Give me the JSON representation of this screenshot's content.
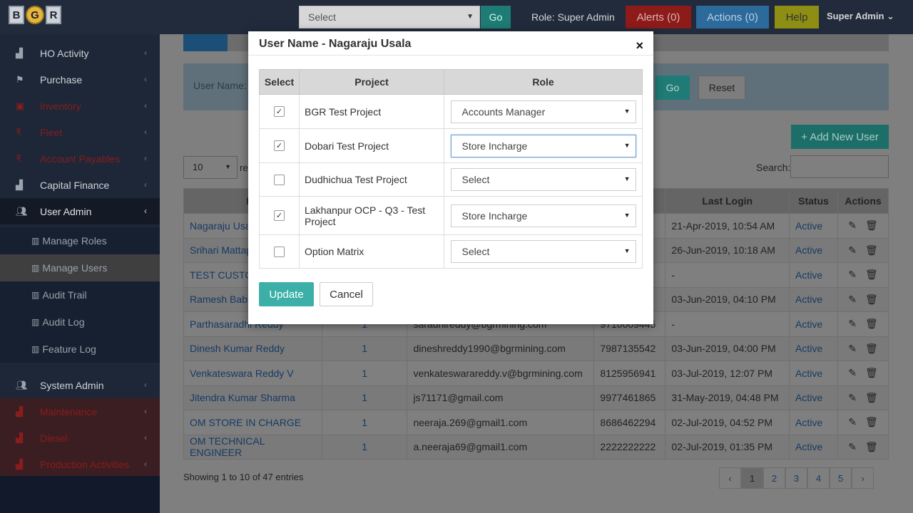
{
  "header": {
    "logo": [
      "B",
      "G",
      "R"
    ],
    "project_select": "Select",
    "go_label": "Go",
    "role_text": "Role: Super Admin",
    "alerts_label": "Alerts (0)",
    "actions_label": "Actions (0)",
    "help_label": "Help",
    "user_menu": "Super Admin"
  },
  "sidebar": {
    "items": [
      {
        "label": "HO Activity",
        "icon": "chart-icon"
      },
      {
        "label": "Purchase",
        "icon": "flag-icon"
      },
      {
        "label": "Inventory",
        "icon": "box-icon"
      },
      {
        "label": "Fleet",
        "icon": "rupee-icon"
      },
      {
        "label": "Account Payables",
        "icon": "rupee-icon"
      },
      {
        "label": "Capital Finance",
        "icon": "chart-icon"
      },
      {
        "label": "User Admin",
        "icon": "users-icon"
      }
    ],
    "subitems": [
      "Manage Roles",
      "Manage Users",
      "Audit Trail",
      "Audit Log",
      "Feature Log"
    ],
    "items_after": [
      {
        "label": "System Admin",
        "icon": "users-icon"
      },
      {
        "label": "Maintenance",
        "icon": "chart-icon"
      },
      {
        "label": "Diesel",
        "icon": "chart-icon"
      },
      {
        "label": "Production Activities",
        "icon": "chart-icon"
      }
    ]
  },
  "page": {
    "filter_label": "User Name:",
    "go_label": "Go",
    "reset_label": "Reset",
    "add_user_label": "+ Add New User",
    "page_length": "10",
    "length_suffix": "re",
    "search_label": "Search:",
    "columns": [
      "Na",
      "",
      "",
      "",
      "Last Login",
      "Status",
      "Actions"
    ],
    "rows": [
      {
        "name": "Nagaraju Usa",
        "count": "",
        "email": "",
        "phone": "4",
        "last_login": "21-Apr-2019, 10:54 AM",
        "status": "Active"
      },
      {
        "name": "Srihari Mattap",
        "count": "",
        "email": "",
        "phone": "9",
        "last_login": "26-Jun-2019, 10:18 AM",
        "status": "Active"
      },
      {
        "name": "TEST CUSTOM",
        "count": "",
        "email": "",
        "phone": "0",
        "last_login": "-",
        "status": "Active"
      },
      {
        "name": "Ramesh Babu",
        "count": "",
        "email": "",
        "phone": "0",
        "last_login": "03-Jun-2019, 04:10 PM",
        "status": "Active"
      },
      {
        "name": "Parthasaradhi Reddy",
        "count": "1",
        "email": "saradhireddy@bgrmining.com",
        "phone": "9710009445",
        "last_login": "-",
        "status": "Active"
      },
      {
        "name": "Dinesh Kumar Reddy",
        "count": "1",
        "email": "dineshreddy1990@bgrmining.com",
        "phone": "7987135542",
        "last_login": "03-Jun-2019, 04:00 PM",
        "status": "Active"
      },
      {
        "name": "Venkateswara Reddy V",
        "count": "1",
        "email": "venkateswarareddy.v@bgrmining.com",
        "phone": "8125956941",
        "last_login": "03-Jul-2019, 12:07 PM",
        "status": "Active"
      },
      {
        "name": "Jitendra Kumar Sharma",
        "count": "1",
        "email": "js71171@gmail.com",
        "phone": "9977461865",
        "last_login": "31-May-2019, 04:48 PM",
        "status": "Active"
      },
      {
        "name": "OM STORE IN CHARGE",
        "count": "1",
        "email": "neeraja.269@gmail1.com",
        "phone": "8686462294",
        "last_login": "02-Jul-2019, 04:52 PM",
        "status": "Active"
      },
      {
        "name": "OM TECHNICAL ENGINEER",
        "count": "1",
        "email": "a.neeraja69@gmail1.com",
        "phone": "2222222222",
        "last_login": "02-Jul-2019, 01:35 PM",
        "status": "Active"
      }
    ],
    "entries_text": "Showing 1 to 10 of 47 entries",
    "pager": [
      "‹",
      "1",
      "2",
      "3",
      "4",
      "5",
      "›"
    ]
  },
  "modal": {
    "title": "User Name - Nagaraju Usala",
    "close": "×",
    "columns": [
      "Select",
      "Project",
      "Role"
    ],
    "rows": [
      {
        "checked": true,
        "project": "BGR Test Project",
        "role": "Accounts Manager"
      },
      {
        "checked": true,
        "project": "Dobari Test Project",
        "role": "Store Incharge"
      },
      {
        "checked": false,
        "project": "Dudhichua Test Project",
        "role": "Select"
      },
      {
        "checked": true,
        "project": "Lakhanpur OCP - Q3 - Test Project",
        "role": "Store Incharge"
      },
      {
        "checked": false,
        "project": "Option Matrix",
        "role": "Select"
      }
    ],
    "update_label": "Update",
    "cancel_label": "Cancel"
  }
}
